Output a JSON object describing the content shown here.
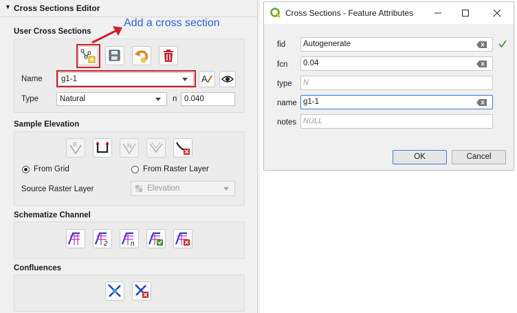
{
  "panel": {
    "title": "Cross Sections Editor",
    "callout": "Add a cross section",
    "user_cs": {
      "title": "User Cross Sections",
      "toolbar": [
        "add-cross-section-icon",
        "save-icon",
        "undo-icon",
        "delete-icon"
      ],
      "name_label": "Name",
      "name_value": "g1-1",
      "rename_icon": "rename-text-icon",
      "eye_icon": "eye-icon",
      "type_label": "Type",
      "type_value": "Natural",
      "n_label": "n",
      "n_value": "0.040"
    },
    "sample_elevation": {
      "title": "Sample Elevation",
      "from_grid": "From Grid",
      "from_raster": "From Raster Layer",
      "selected": "From Grid",
      "source_label": "Source Raster Layer",
      "source_value": "Elevation"
    },
    "schematize": {
      "title": "Schematize Channel"
    },
    "confluences": {
      "title": "Confluences"
    }
  },
  "dialog": {
    "title": "Cross Sections - Feature Attributes",
    "fields": [
      {
        "label": "fid",
        "value": "Autogenerate",
        "placeholder": ""
      },
      {
        "label": "fcn",
        "value": "0.04",
        "placeholder": ""
      },
      {
        "label": "type",
        "value": "",
        "placeholder": "N"
      },
      {
        "label": "name",
        "value": "g1-1",
        "placeholder": ""
      },
      {
        "label": "notes",
        "value": "",
        "placeholder": "NULL"
      }
    ],
    "ok_label": "OK",
    "cancel_label": "Cancel",
    "accent": "#3d7bd6"
  }
}
